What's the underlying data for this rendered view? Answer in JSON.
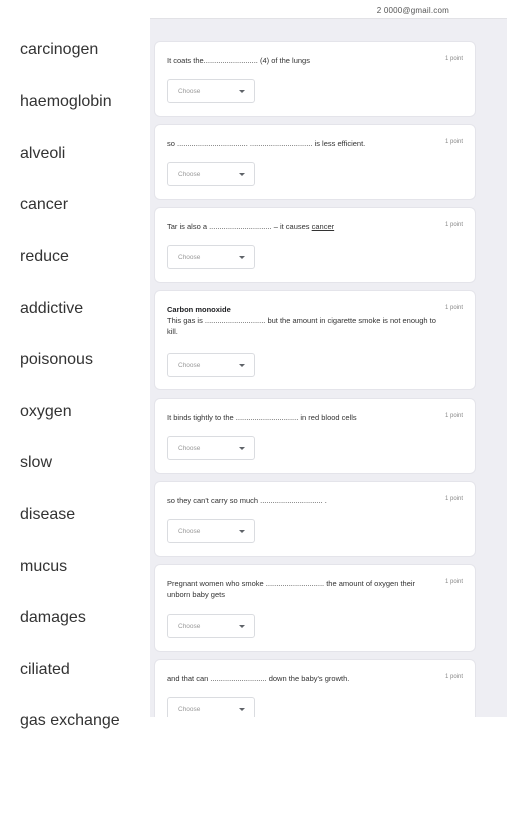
{
  "word_bank": [
    "carcinogen",
    "haemoglobin",
    "alveoli",
    "cancer",
    "reduce",
    "addictive",
    "poisonous",
    "oxygen",
    "slow",
    "disease",
    "mucus",
    "damages",
    "ciliated",
    "gas exchange"
  ],
  "form": {
    "header_email": "2 0000@gmail.com",
    "questions": [
      {
        "text": "It coats the.......................... (4) of the lungs",
        "points": "1 point",
        "dropdown": "Choose"
      },
      {
        "text": "so ..................................  .............................. is less efficient.",
        "points": "1 point",
        "dropdown": "Choose"
      },
      {
        "text_before": "Tar is also a .............................. – it causes ",
        "text_link": "cancer",
        "points": "1 point",
        "dropdown": "Choose"
      },
      {
        "title": "Carbon monoxide",
        "text": "This gas is ............................. but the amount in cigarette smoke is not enough to kill.",
        "points": "1 point",
        "dropdown": "Choose"
      },
      {
        "text": "It binds tightly to the .............................. in red blood cells",
        "points": "1 point",
        "dropdown": "Choose"
      },
      {
        "text": "so they can't carry so much .............................. .",
        "points": "1 point",
        "dropdown": "Choose"
      },
      {
        "text": "Pregnant women who smoke ............................ the amount of oxygen their unborn baby gets",
        "points": "1 point",
        "dropdown": "Choose"
      },
      {
        "text": "and that can ........................... down the baby's growth.",
        "points": "1 point",
        "dropdown": "Choose"
      }
    ]
  }
}
